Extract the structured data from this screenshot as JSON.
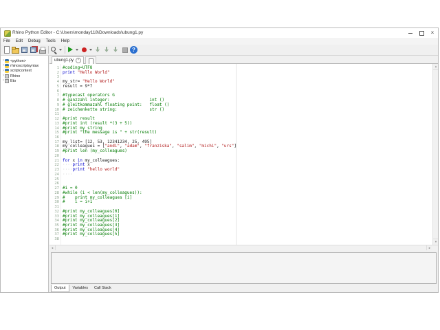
{
  "window": {
    "title": "Rhino Python Editor - C:\\Users\\monday118\\Downloads\\ubung1.py",
    "controls": [
      "minimize",
      "maximize",
      "close"
    ]
  },
  "menu": {
    "items": [
      "File",
      "Edit",
      "Debug",
      "Tools",
      "Help"
    ]
  },
  "toolbar": {
    "items": [
      "new",
      "open",
      "save",
      "saveall",
      "print",
      "sep",
      "search",
      "caret",
      "sep",
      "run",
      "caret",
      "record",
      "caret",
      "stepin",
      "stepover",
      "stepout",
      "stop",
      "help"
    ]
  },
  "sidebar": {
    "items": [
      {
        "label": "<python>",
        "icon": "python"
      },
      {
        "label": "rhinoscriptsyntax",
        "icon": "python"
      },
      {
        "label": "scriptcontext",
        "icon": "python"
      },
      {
        "label": "Rhino",
        "icon": "module"
      },
      {
        "label": "Eto",
        "icon": "module"
      }
    ]
  },
  "editor": {
    "tab": {
      "label": "ubung1.py",
      "close_icon": "x-circle"
    },
    "new_tab_icon": "new-page",
    "lines": [
      [
        [
          "c",
          "#coding=UTF8"
        ]
      ],
      [
        [
          "k",
          "print"
        ],
        [
          "p",
          " "
        ],
        [
          "s",
          "\"Hello World\""
        ]
      ],
      [],
      [
        [
          "p",
          "my_str= "
        ],
        [
          "s",
          "\"Hello World\""
        ]
      ],
      [
        [
          "p",
          "result = 9*7"
        ]
      ],
      [],
      [
        [
          "c",
          "#typecast operators G"
        ]
      ],
      [
        [
          "c",
          "# ganzzahl integer:                int ()"
        ]
      ],
      [
        [
          "c",
          "# gleitkommazahl floating point:   float ()"
        ]
      ],
      [
        [
          "c",
          "# zeichenkette string:             str ()"
        ]
      ],
      [],
      [
        [
          "c",
          "#print result"
        ]
      ],
      [
        [
          "c",
          "#print int (result *(3 + 5))"
        ]
      ],
      [
        [
          "c",
          "#print my_string"
        ]
      ],
      [
        [
          "c",
          "#print \"the message is \" + str(result)"
        ]
      ],
      [],
      [
        [
          "p",
          "my_list= [12, 53, 12341234, 25, 495]"
        ]
      ],
      [
        [
          "p",
          "my_colleagues = ["
        ],
        [
          "s",
          "\"andi\""
        ],
        [
          "p",
          ", "
        ],
        [
          "s",
          "\"adam\""
        ],
        [
          "p",
          ", "
        ],
        [
          "s",
          "\"franziska\""
        ],
        [
          "p",
          ", "
        ],
        [
          "s",
          "\"salim\""
        ],
        [
          "p",
          ", "
        ],
        [
          "s",
          "\"michi\""
        ],
        [
          "p",
          ", "
        ],
        [
          "s",
          "\"urs\""
        ],
        [
          "p",
          "]"
        ]
      ],
      [
        [
          "c",
          "#print len (my_colleagues)"
        ]
      ],
      [],
      [
        [
          "k",
          "for"
        ],
        [
          "p",
          " x "
        ],
        [
          "k",
          "in"
        ],
        [
          "p",
          " my_colleagues:"
        ]
      ],
      [
        [
          "w",
          "····"
        ],
        [
          "k",
          "print"
        ],
        [
          "p",
          " x"
        ]
      ],
      [
        [
          "w",
          "····"
        ],
        [
          "k",
          "print"
        ],
        [
          "p",
          " "
        ],
        [
          "s",
          "\"hello world\""
        ]
      ],
      [
        [
          "w",
          "····"
        ]
      ],
      [],
      [],
      [
        [
          "c",
          "#i = 0"
        ]
      ],
      [
        [
          "c",
          "#while (i < len(my_colleagues)):"
        ]
      ],
      [
        [
          "c",
          "#    print my_colleagues [i]"
        ]
      ],
      [
        [
          "c",
          "#    i = i+1"
        ]
      ],
      [],
      [
        [
          "c",
          "#print my_colleagues[0]"
        ]
      ],
      [
        [
          "c",
          "#print my_colleagues[1]"
        ]
      ],
      [
        [
          "c",
          "#print my_colleagues[2]"
        ]
      ],
      [
        [
          "c",
          "#print my_colleagues[3]"
        ]
      ],
      [
        [
          "c",
          "#print my_colleagues[4]"
        ]
      ],
      [
        [
          "c",
          "#print my_colleagues[5]"
        ]
      ],
      []
    ]
  },
  "output": {
    "tabs": [
      {
        "label": "Output",
        "active": true
      },
      {
        "label": "Variables",
        "active": false
      },
      {
        "label": "Call Stack",
        "active": false
      }
    ],
    "content": ""
  },
  "colors": {
    "comment": "#007a00",
    "keyword": "#0000cc",
    "string": "#b01818",
    "linenumber": "#8fa58f",
    "run_green": "#1f9a1f",
    "record_red": "#cc2222",
    "help_blue": "#2a6fd0"
  }
}
